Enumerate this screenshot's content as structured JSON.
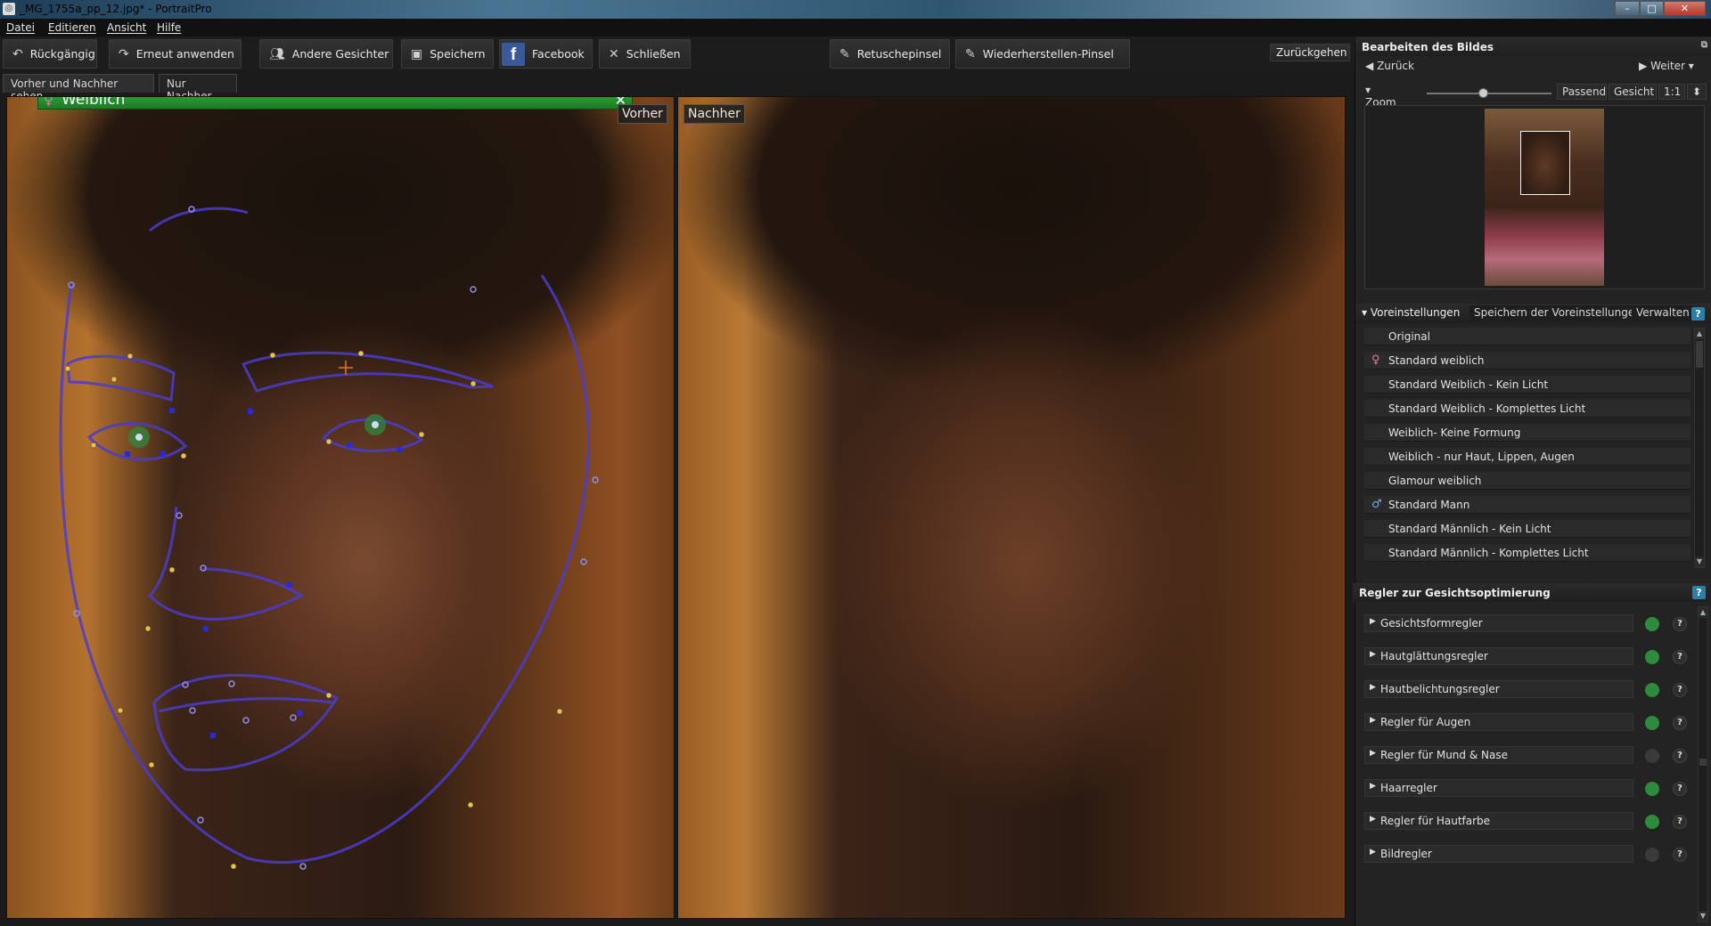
{
  "window": {
    "title": "_MG_1755a_pp_12.jpg* - PortraitPro",
    "controls": [
      "–",
      "□",
      "✕"
    ]
  },
  "menu": [
    "Datei",
    "Editieren",
    "Ansicht",
    "Hilfe"
  ],
  "toolbar": {
    "undo": "Rückgängig",
    "redo": "Erneut anwenden",
    "other_faces": "Andere Gesichter",
    "save": "Speichern",
    "facebook": "Facebook",
    "close": "Schließen",
    "retouch_brush": "Retuschepinsel",
    "restore_brush": "Wiederherstellen-Pinsel",
    "back": "Zurückgehen"
  },
  "view_tabs": [
    "Vorher und Nachher sehen",
    "Nur Nachher"
  ],
  "panes": {
    "before_label": "Vorher",
    "after_label": "Nachher",
    "gender_label": "Weiblich",
    "gender_close": "✕"
  },
  "edit_panel": {
    "title": "Bearbeiten des Bildes",
    "prev": "Zurück",
    "next": "Weiter",
    "zoom_label": "Zoom",
    "zoom_buttons": [
      "Passend",
      "Gesicht",
      "1:1"
    ],
    "zoom_level": 0.45
  },
  "presets": {
    "header": "Voreinstellungen",
    "save_presets": "Speichern der Voreinstellungen",
    "manage": "Verwalten",
    "items": [
      {
        "label": "Original",
        "icon": ""
      },
      {
        "label": "Standard weiblich",
        "icon": "female-icon"
      },
      {
        "label": "Standard Weiblich - Kein Licht",
        "icon": ""
      },
      {
        "label": "Standard Weiblich - Komplettes Licht",
        "icon": ""
      },
      {
        "label": "Weiblich- Keine Formung",
        "icon": ""
      },
      {
        "label": "Weiblich - nur Haut, Lippen, Augen",
        "icon": ""
      },
      {
        "label": "Glamour weiblich",
        "icon": ""
      },
      {
        "label": "Standard Mann",
        "icon": "male-icon"
      },
      {
        "label": "Standard Männlich - Kein Licht",
        "icon": ""
      },
      {
        "label": "Standard Männlich - Komplettes Licht",
        "icon": ""
      }
    ]
  },
  "controls": {
    "header": "Regler zur Gesichtsoptimierung",
    "items": [
      {
        "label": "Gesichtsformregler",
        "active": true
      },
      {
        "label": "Hautglättungsregler",
        "active": true
      },
      {
        "label": "Hautbelichtungsregler",
        "active": true
      },
      {
        "label": "Regler für Augen",
        "active": true
      },
      {
        "label": "Regler für Mund & Nase",
        "active": false
      },
      {
        "label": "Haarregler",
        "active": true
      },
      {
        "label": "Regler für Hautfarbe",
        "active": true
      },
      {
        "label": "Bildregler",
        "active": false
      }
    ],
    "help_glyph": "?"
  },
  "colors": {
    "active_dot": "#2e8b3e",
    "inactive_dot": "#3a3a3a",
    "accent": "#2e7fa8",
    "gender_bar": "#2fa339",
    "outline": "#4a3ccf"
  }
}
